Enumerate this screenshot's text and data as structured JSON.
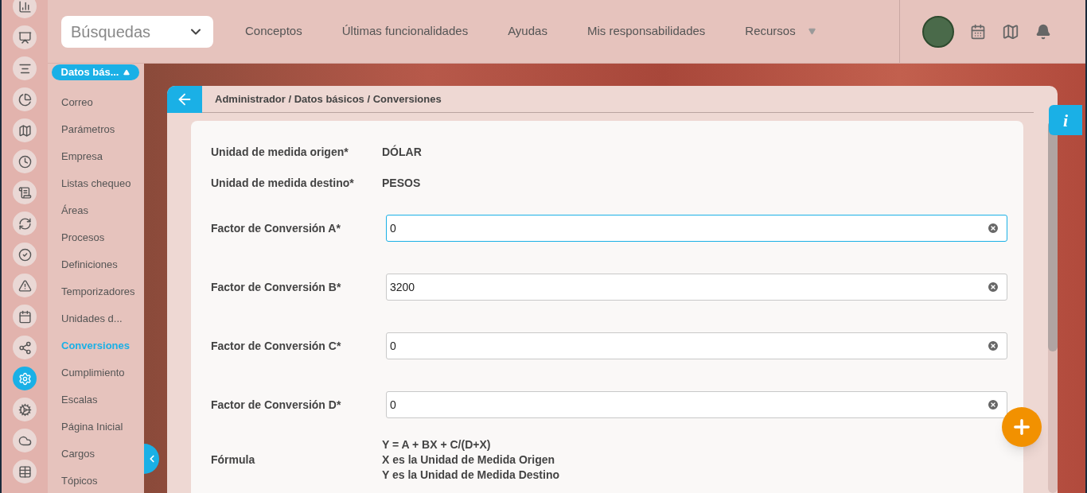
{
  "search": {
    "value": "Búsquedas"
  },
  "top_nav": [
    {
      "label": "Conceptos",
      "has_menu": false
    },
    {
      "label": "Últimas funcionalidades",
      "has_menu": false
    },
    {
      "label": "Ayudas",
      "has_menu": false
    },
    {
      "label": "Mis responsabilidades",
      "has_menu": false
    },
    {
      "label": "Recursos",
      "has_menu": true
    }
  ],
  "rail": [
    {
      "kind": "bar-chart",
      "selected": false
    },
    {
      "kind": "presentation",
      "selected": false
    },
    {
      "kind": "align",
      "selected": false
    },
    {
      "kind": "pie",
      "selected": false
    },
    {
      "kind": "map",
      "selected": false
    },
    {
      "kind": "clock",
      "selected": false
    },
    {
      "kind": "list",
      "selected": false
    },
    {
      "kind": "cycle",
      "selected": false
    },
    {
      "kind": "check",
      "selected": false
    },
    {
      "kind": "warning",
      "selected": false
    },
    {
      "kind": "calendar",
      "selected": false
    },
    {
      "kind": "network",
      "selected": false
    },
    {
      "kind": "gear",
      "selected": true
    },
    {
      "kind": "gears",
      "selected": false
    },
    {
      "kind": "cloud",
      "selected": false
    },
    {
      "kind": "table",
      "selected": false
    }
  ],
  "sidebar": {
    "dropdown": "Datos bás...",
    "items": [
      {
        "label": "Correo",
        "selected": false
      },
      {
        "label": "Parámetros",
        "selected": false
      },
      {
        "label": "Empresa",
        "selected": false
      },
      {
        "label": "Listas chequeo",
        "selected": false
      },
      {
        "label": "Áreas",
        "selected": false
      },
      {
        "label": "Procesos",
        "selected": false
      },
      {
        "label": "Definiciones",
        "selected": false
      },
      {
        "label": "Temporizadores",
        "selected": false
      },
      {
        "label": "Unidades d...",
        "selected": false
      },
      {
        "label": "Conversiones",
        "selected": true
      },
      {
        "label": "Cumplimiento",
        "selected": false
      },
      {
        "label": "Escalas",
        "selected": false
      },
      {
        "label": "Página Inicial",
        "selected": false
      },
      {
        "label": "Cargos",
        "selected": false
      },
      {
        "label": "Tópicos",
        "selected": false
      }
    ]
  },
  "breadcrumb": "Administrador / Datos básicos / Conversiones",
  "info_button": "i",
  "form": {
    "fields": [
      {
        "kind": "static",
        "label": "Unidad de medida origen*",
        "value": "DÓLAR"
      },
      {
        "kind": "static",
        "label": "Unidad de medida destino*",
        "value": "PESOS"
      },
      {
        "kind": "input",
        "label": "Factor de Conversión A*",
        "value": "0",
        "focused": true
      },
      {
        "kind": "input",
        "label": "Factor de Conversión B*",
        "value": "3200",
        "focused": false
      },
      {
        "kind": "input",
        "label": "Factor de Conversión C*",
        "value": "0",
        "focused": false
      },
      {
        "kind": "input",
        "label": "Factor de Conversión D*",
        "value": "0",
        "focused": false
      },
      {
        "kind": "lines",
        "label": "Fórmula",
        "lines": [
          "Y = A + BX + C/(D+X)",
          "X es la Unidad de Medida Origen",
          "Y es la Unidad de Medida Destino"
        ]
      }
    ]
  }
}
